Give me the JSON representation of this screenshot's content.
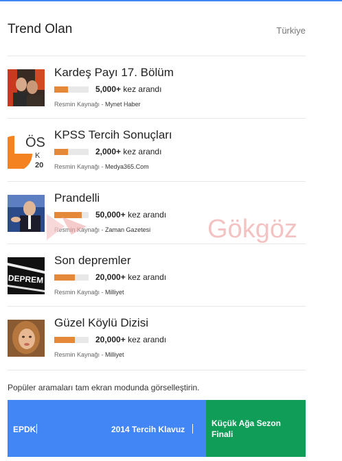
{
  "header": {
    "title": "Trend Olan",
    "region": "Türkiye"
  },
  "trends": [
    {
      "title": "Kardeş Payı 17. Bölüm",
      "count": "5,000+",
      "count_suffix": "kez arandı",
      "source_label": "Resmin Kaynağı -",
      "source_name": "Mynet Haber",
      "level": 0.4
    },
    {
      "title": "KPSS Tercih Sonuçları",
      "count": "2,000+",
      "count_suffix": "kez arandı",
      "source_label": "Resmin Kaynağı -",
      "source_name": "Medya365.Com",
      "level": 0.4
    },
    {
      "title": "Prandelli",
      "count": "50,000+",
      "count_suffix": "kez arandı",
      "source_label": "Resmin Kaynağı -",
      "source_name": "Zaman Gazetesi",
      "level": 0.8
    },
    {
      "title": "Son depremler",
      "count": "20,000+",
      "count_suffix": "kez arandı",
      "source_label": "Resmin Kaynağı -",
      "source_name": "Milliyet",
      "level": 0.6
    },
    {
      "title": "Güzel Köylü Dizisi",
      "count": "20,000+",
      "count_suffix": "kez arandı",
      "source_label": "Resmin Kaynağı -",
      "source_name": "Milliyet",
      "level": 0.6
    }
  ],
  "thumbnails": {
    "osym_text": "ÖS",
    "osym_sub": "K",
    "osym_sub2": "20",
    "deprem_text": "DEPREM"
  },
  "footer": {
    "text": "Popüler aramaları tam ekran modunda görselleştirin."
  },
  "tiles": {
    "epdk": "EPDK",
    "tercih": "2014 Tercih Klavuz",
    "kucuk_aga": "Küçük Ağa Sezon Finali"
  },
  "watermark": {
    "text": "Gökgöz"
  },
  "colors": {
    "accent": "#4285f4",
    "green": "#0f9d58",
    "bar": "#e4893a"
  }
}
